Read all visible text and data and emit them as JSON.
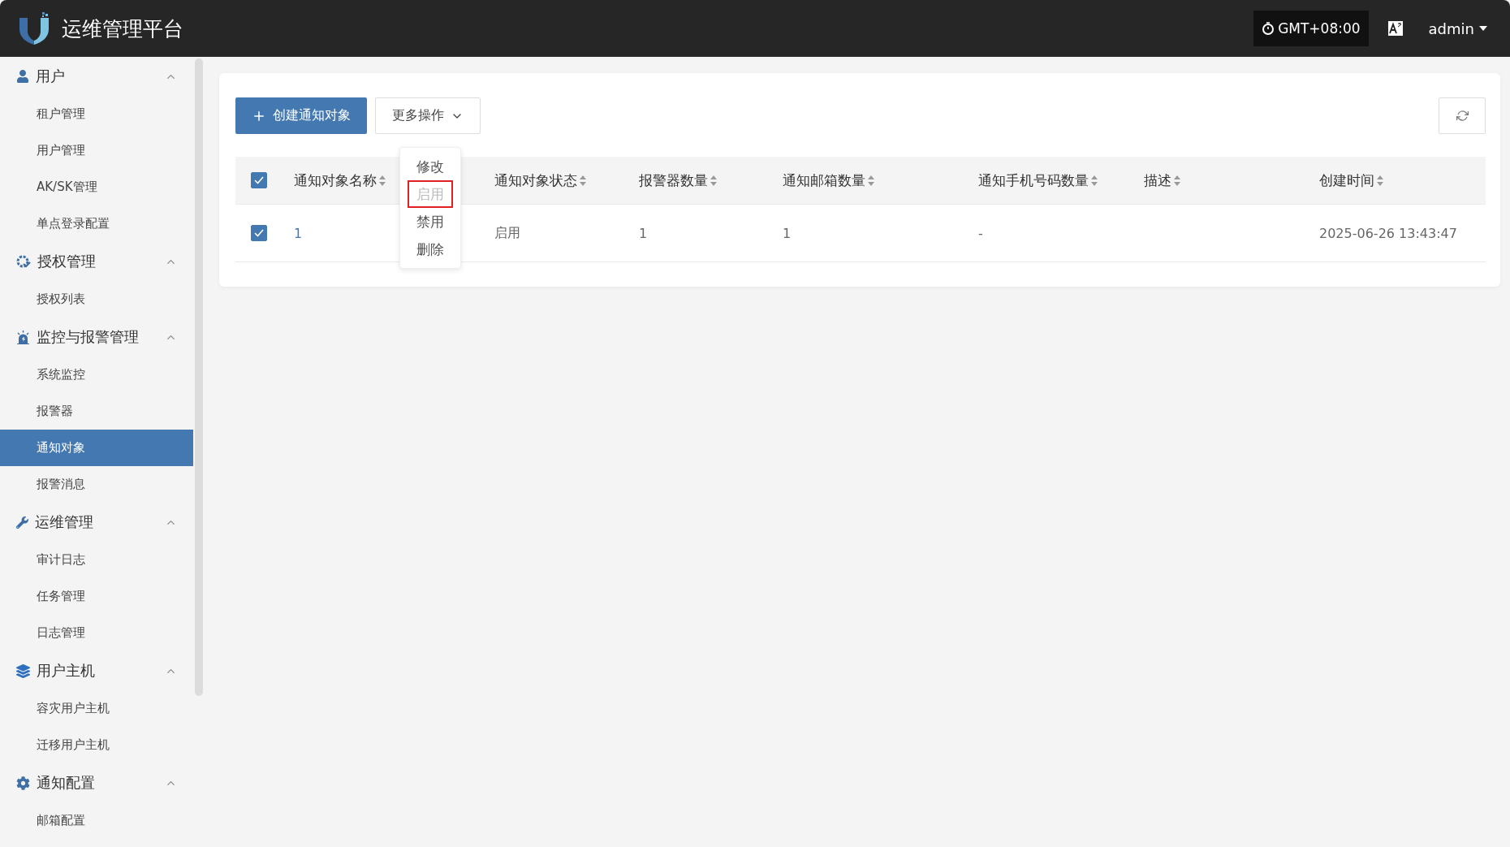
{
  "header": {
    "title": "运维管理平台",
    "timezone": "GMT+08:00",
    "user": "admin"
  },
  "sidebar": {
    "groups": [
      {
        "label": "用户",
        "expanded": true,
        "children": [
          {
            "label": "租户管理",
            "selected": false
          },
          {
            "label": "用户管理",
            "selected": false
          },
          {
            "label": "AK/SK管理",
            "selected": false
          },
          {
            "label": "单点登录配置",
            "selected": false
          }
        ]
      },
      {
        "label": "授权管理",
        "expanded": true,
        "children": [
          {
            "label": "授权列表",
            "selected": false
          }
        ]
      },
      {
        "label": "监控与报警管理",
        "expanded": true,
        "children": [
          {
            "label": "系统监控",
            "selected": false
          },
          {
            "label": "报警器",
            "selected": false
          },
          {
            "label": "通知对象",
            "selected": true
          },
          {
            "label": "报警消息",
            "selected": false
          }
        ]
      },
      {
        "label": "运维管理",
        "expanded": true,
        "children": [
          {
            "label": "审计日志",
            "selected": false
          },
          {
            "label": "任务管理",
            "selected": false
          },
          {
            "label": "日志管理",
            "selected": false
          }
        ]
      },
      {
        "label": "用户主机",
        "expanded": true,
        "children": [
          {
            "label": "容灾用户主机",
            "selected": false
          },
          {
            "label": "迁移用户主机",
            "selected": false
          }
        ]
      },
      {
        "label": "通知配置",
        "expanded": true,
        "children": [
          {
            "label": "邮箱配置",
            "selected": false
          }
        ]
      }
    ]
  },
  "toolbar": {
    "create_button": "创建通知对象",
    "more_button": "更多操作",
    "more_menu": [
      {
        "label": "修改",
        "disabled": false,
        "outlined": false
      },
      {
        "label": "启用",
        "disabled": true,
        "outlined": true
      },
      {
        "label": "禁用",
        "disabled": false,
        "outlined": false
      },
      {
        "label": "删除",
        "disabled": false,
        "outlined": false
      }
    ]
  },
  "table": {
    "all_checked": true,
    "columns": [
      "通知对象名称",
      "通知对象状态",
      "报警器数量",
      "通知邮箱数量",
      "通知手机号码数量",
      "描述",
      "创建时间"
    ],
    "rows": [
      {
        "checked": true,
        "cells": [
          "1",
          "启用",
          "1",
          "1",
          "-",
          "",
          "2025-06-26 13:43:47"
        ]
      }
    ]
  }
}
